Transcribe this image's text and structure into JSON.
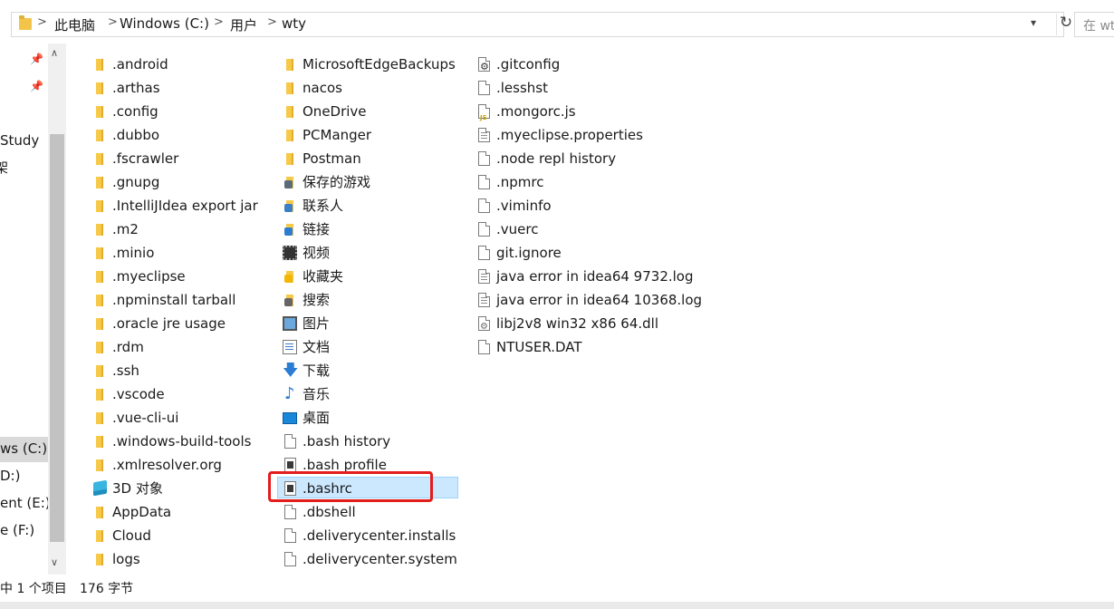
{
  "address_bar": {
    "breadcrumbs": [
      "此电脑",
      "Windows (C:)",
      "用户",
      "wty"
    ],
    "search_placeholder": "在 wty"
  },
  "nav_pane": {
    "items": [
      "Study",
      "架",
      "ws (C:)",
      "D:)",
      "ent (E:)",
      "e (F:)"
    ]
  },
  "files": {
    "column1": [
      {
        "name": ".android",
        "icon": "folder-icon"
      },
      {
        "name": ".arthas",
        "icon": "folder-icon"
      },
      {
        "name": ".config",
        "icon": "folder-icon"
      },
      {
        "name": ".dubbo",
        "icon": "folder-icon"
      },
      {
        "name": ".fscrawler",
        "icon": "folder-icon"
      },
      {
        "name": ".gnupg",
        "icon": "folder-icon"
      },
      {
        "name": ".IntelliJIdea export jar",
        "icon": "folder-icon"
      },
      {
        "name": ".m2",
        "icon": "folder-icon"
      },
      {
        "name": ".minio",
        "icon": "folder-icon"
      },
      {
        "name": ".myeclipse",
        "icon": "folder-icon"
      },
      {
        "name": ".npminstall tarball",
        "icon": "folder-icon"
      },
      {
        "name": ".oracle jre usage",
        "icon": "folder-icon"
      },
      {
        "name": ".rdm",
        "icon": "folder-icon"
      },
      {
        "name": ".ssh",
        "icon": "folder-icon"
      },
      {
        "name": ".vscode",
        "icon": "folder-icon"
      },
      {
        "name": ".vue-cli-ui",
        "icon": "folder-icon"
      },
      {
        "name": ".windows-build-tools",
        "icon": "folder-icon"
      },
      {
        "name": ".xmlresolver.org",
        "icon": "folder-icon"
      },
      {
        "name": "3D 对象",
        "icon": "3d-objects-icon"
      },
      {
        "name": "AppData",
        "icon": "folder-icon"
      },
      {
        "name": "Cloud",
        "icon": "folder-icon"
      },
      {
        "name": "logs",
        "icon": "folder-icon"
      }
    ],
    "column2": [
      {
        "name": "MicrosoftEdgeBackups",
        "icon": "folder-icon"
      },
      {
        "name": "nacos",
        "icon": "folder-icon"
      },
      {
        "name": "OneDrive",
        "icon": "folder-icon"
      },
      {
        "name": "PCManger",
        "icon": "folder-icon"
      },
      {
        "name": "Postman",
        "icon": "folder-icon"
      },
      {
        "name": "保存的游戏",
        "icon": "saved-games-icon"
      },
      {
        "name": "联系人",
        "icon": "contacts-icon"
      },
      {
        "name": "链接",
        "icon": "links-icon"
      },
      {
        "name": "视频",
        "icon": "video-icon"
      },
      {
        "name": "收藏夹",
        "icon": "favorites-icon"
      },
      {
        "name": "搜索",
        "icon": "searches-icon"
      },
      {
        "name": "图片",
        "icon": "pictures-icon"
      },
      {
        "name": "文档",
        "icon": "documents-icon"
      },
      {
        "name": "下载",
        "icon": "downloads-icon"
      },
      {
        "name": "音乐",
        "icon": "music-icon"
      },
      {
        "name": "桌面",
        "icon": "desktop-icon"
      },
      {
        "name": ".bash history",
        "icon": "file-icon"
      },
      {
        "name": ".bash profile",
        "icon": "bash-file-icon"
      },
      {
        "name": ".bashrc",
        "icon": "bash-file-icon"
      },
      {
        "name": ".dbshell",
        "icon": "file-icon"
      },
      {
        "name": ".deliverycenter.installs",
        "icon": "file-icon"
      },
      {
        "name": ".deliverycenter.system",
        "icon": "file-icon"
      }
    ],
    "column3": [
      {
        "name": ".gitconfig",
        "icon": "config-file-icon"
      },
      {
        "name": ".lesshst",
        "icon": "file-icon"
      },
      {
        "name": ".mongorc.js",
        "icon": "js-file-icon"
      },
      {
        "name": ".myeclipse.properties",
        "icon": "text-file-icon"
      },
      {
        "name": ".node repl history",
        "icon": "file-icon"
      },
      {
        "name": ".npmrc",
        "icon": "file-icon"
      },
      {
        "name": ".viminfo",
        "icon": "file-icon"
      },
      {
        "name": ".vuerc",
        "icon": "file-icon"
      },
      {
        "name": "git.ignore",
        "icon": "file-icon"
      },
      {
        "name": "java error in idea64 9732.log",
        "icon": "text-file-icon"
      },
      {
        "name": "java error in idea64 10368.log",
        "icon": "text-file-icon"
      },
      {
        "name": "libj2v8 win32 x86 64.dll",
        "icon": "dll-file-icon"
      },
      {
        "name": "NTUSER.DAT",
        "icon": "blank-icon"
      }
    ],
    "selected": ".bashrc"
  },
  "status_bar": {
    "selection": "中 1 个项目",
    "size": "176 字节"
  }
}
